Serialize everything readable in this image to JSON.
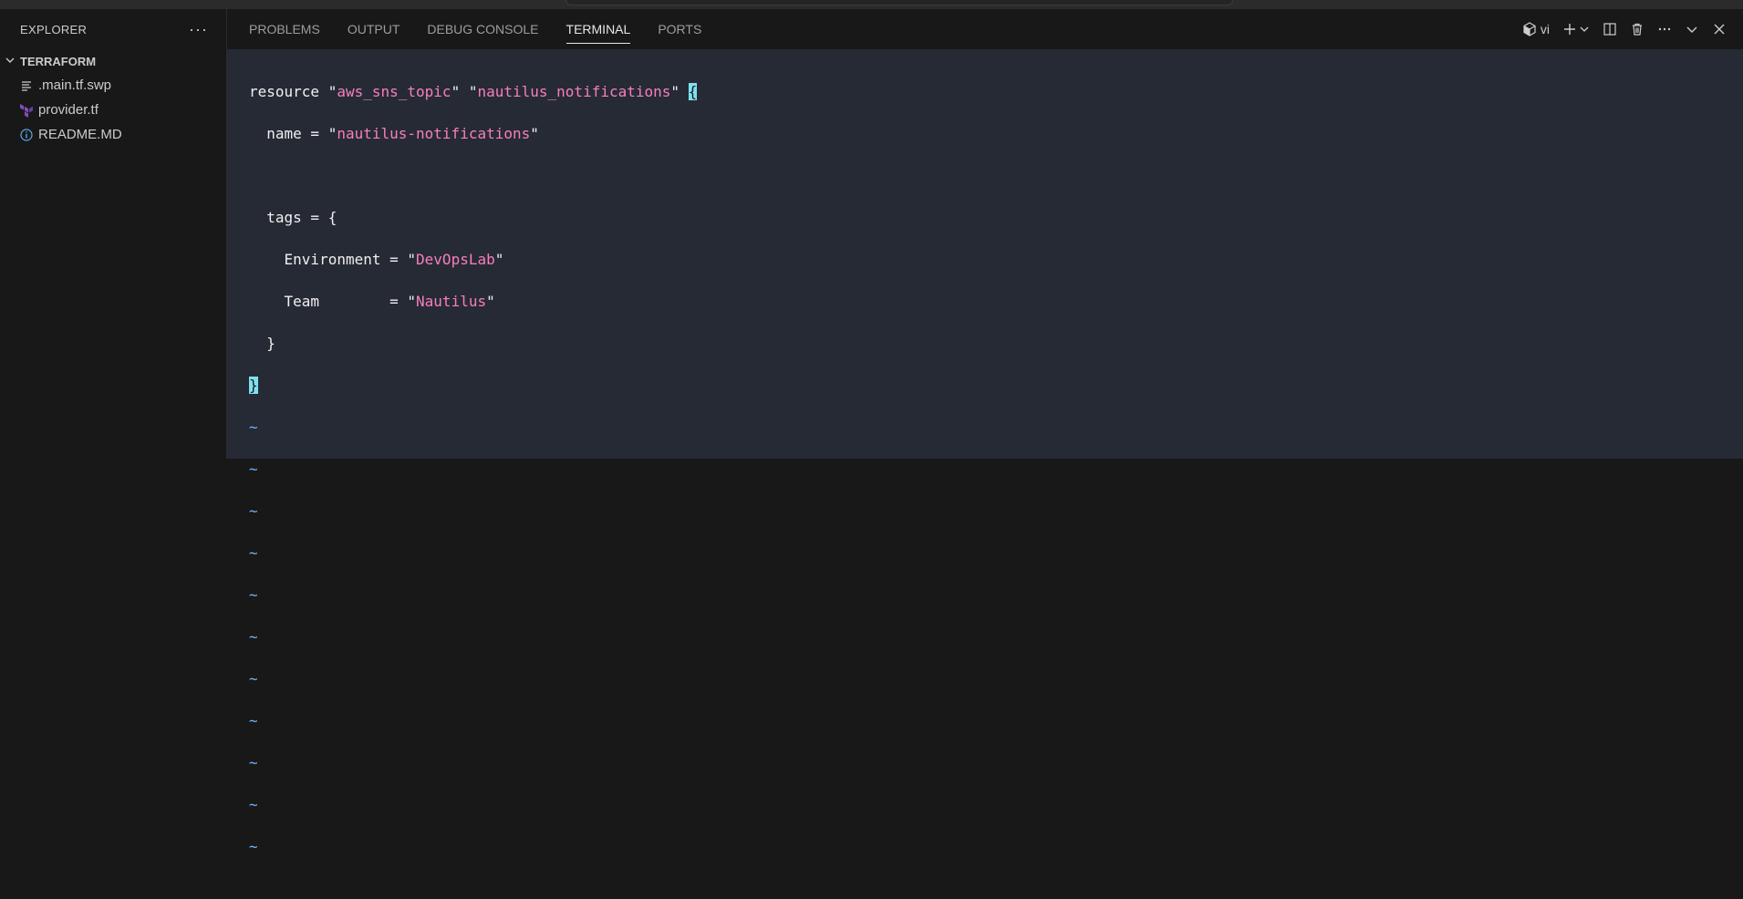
{
  "sidebar": {
    "title": "EXPLORER",
    "more": "···",
    "folder": "TERRAFORM",
    "files": [
      {
        "name": ".main.tf.swp",
        "icon": "lines-icon"
      },
      {
        "name": "provider.tf",
        "icon": "terraform-icon"
      },
      {
        "name": "README.MD",
        "icon": "info-icon"
      }
    ]
  },
  "panel": {
    "tabs": [
      "PROBLEMS",
      "OUTPUT",
      "DEBUG CONSOLE",
      "TERMINAL",
      "PORTS"
    ],
    "active_tab": "TERMINAL",
    "terminal_name": "vi"
  },
  "terminal": {
    "l1a": "resource \"",
    "l1b": "aws_sns_topic",
    "l1c": "\" \"",
    "l1d": "nautilus_notifications",
    "l1e": "\" ",
    "l1f": "{",
    "l2a": "  name = \"",
    "l2b": "nautilus-notifications",
    "l2c": "\"",
    "l4": "  tags = {",
    "l5a": "    Environment = \"",
    "l5b": "DevOpsLab",
    "l5c": "\"",
    "l6a": "    Team        = \"",
    "l6b": "Nautilus",
    "l6c": "\"",
    "l7": "  }",
    "l8": "}",
    "tilde": "~"
  }
}
